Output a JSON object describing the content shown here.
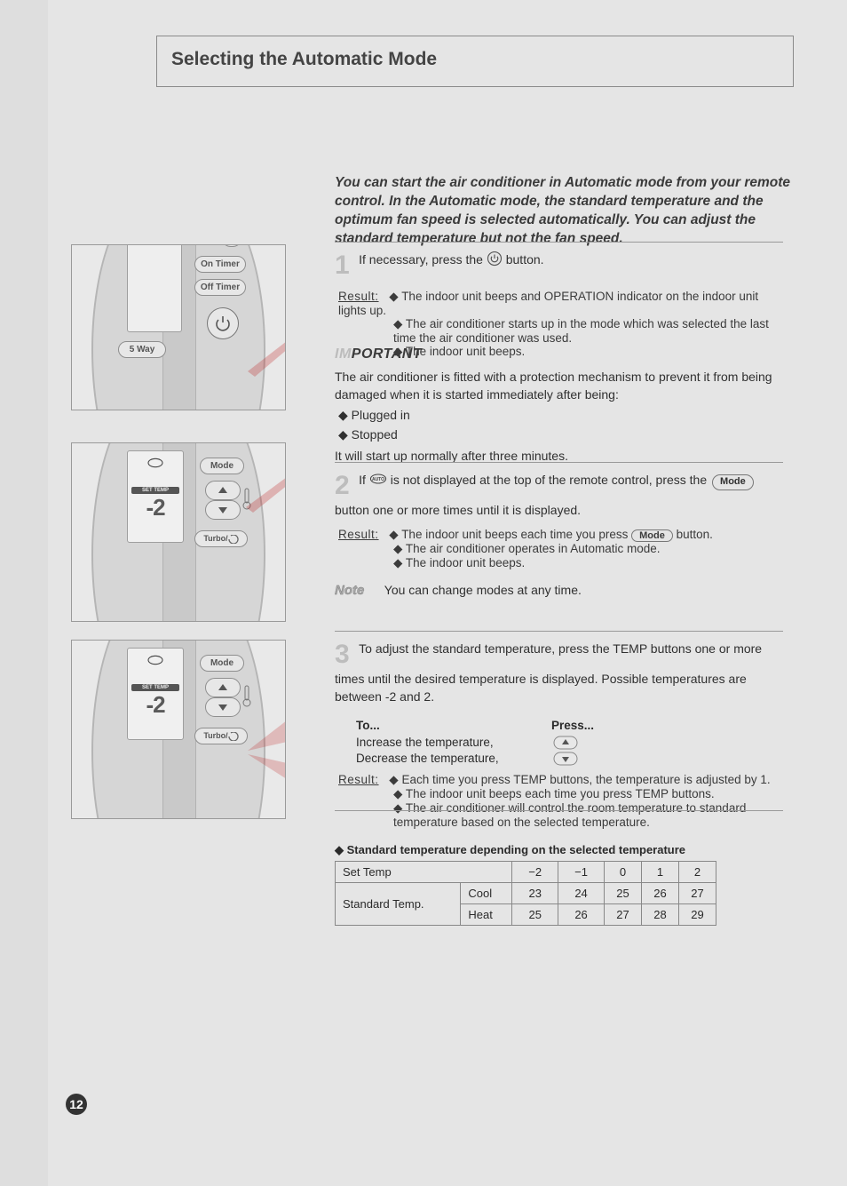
{
  "header": {
    "title": "Selecting the Automatic Mode"
  },
  "intro": "You can start the air conditioner in Automatic mode from your remote control. In the Automatic mode, the standard temperature and the optimum fan speed is selected automatically. You can adjust the standard temperature but not the fan speed.",
  "steps": {
    "s1": {
      "num": "1",
      "line1": "If necessary, press the ",
      "line1b": " button.",
      "resultLabel": "Result:",
      "resultBullets": [
        "The indoor unit beeps and OPERATION indicator on the indoor unit lights up.",
        "The air conditioner starts up in the mode which was selected the last time the air conditioner was used.",
        "The indoor unit beeps."
      ]
    },
    "important": {
      "label_a": "IM",
      "label_b": "PORTANT",
      "text": "The air conditioner is fitted with a protection mechanism to prevent it from being damaged when it is started immediately after being:",
      "bullets": [
        "Plugged in",
        "Stopped"
      ],
      "tail": "It will start up normally after three minutes."
    },
    "s2": {
      "num": "2",
      "line": "If ",
      "lineTail": " is not displayed at the top of the remote control, press the",
      "modeWord": "Mode",
      "lineTail2": " button one or more times until it is displayed.",
      "resultLabel": "Result:",
      "resultBullets": [
        "The indoor unit beeps each time you press ",
        "The air conditioner operates in Automatic mode.",
        "The indoor unit beeps."
      ],
      "modeTail": " button."
    },
    "note": {
      "label": "Note",
      "text": "You can change modes at any time."
    },
    "s3": {
      "num": "3",
      "intro": "To adjust the standard temperature, press the TEMP buttons one or more times until the desired temperature is displayed. Possible temperatures are between -2 and 2.",
      "rows": [
        {
          "to": "To...",
          "press": "Press..."
        },
        {
          "to": "Increase the temperature,",
          "press": "▲"
        },
        {
          "to": "Decrease the temperature,",
          "press": "▼"
        }
      ],
      "resultLabel": "Result:",
      "resultBullets": [
        "Each time you press TEMP buttons, the temperature is adjusted by 1.",
        "The indoor unit beeps each time you press TEMP buttons.",
        "The air conditioner will control the room temperature to standard temperature based on the selected temperature."
      ],
      "tableHeader": "Standard temperature depending on the selected temperature",
      "tableCols": [
        "Set Temp",
        "",
        "−2",
        "−1",
        "0",
        "1",
        "2"
      ],
      "tableRows": [
        {
          "label": "Standard Temp.",
          "sub": "Cool",
          "vals": [
            "23",
            "24",
            "25",
            "26",
            "27"
          ]
        },
        {
          "label": "",
          "sub": "Heat",
          "vals": [
            "25",
            "26",
            "27",
            "28",
            "29"
          ]
        }
      ]
    }
  },
  "remote": {
    "fiveWay": "5 Way",
    "onTimer": "On Timer",
    "offTimer": "Off Timer",
    "mode": "Mode",
    "turbo": "Turbo/",
    "setTemp": "SET TEMP",
    "seg": "-2"
  },
  "pageNumber": "12",
  "icons": {
    "power": "power-icon",
    "auto": "auto-mode-icon",
    "up": "temp-up-icon",
    "down": "temp-down-icon",
    "sleep": "sleep-icon"
  }
}
